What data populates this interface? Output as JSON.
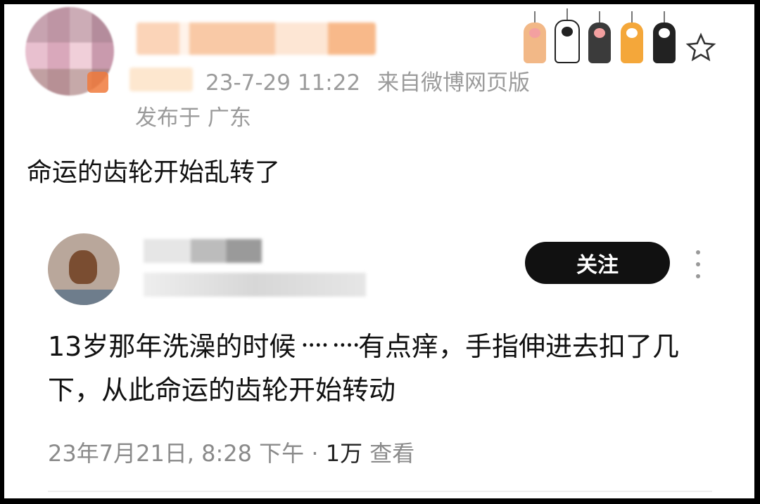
{
  "post": {
    "timestamp": "23-7-29 11:22",
    "source": "来自微博网页版",
    "location": "发布于 广东",
    "text": "命运的齿轮开始乱转了"
  },
  "decor": {
    "paw_colors": [
      "#f2b887",
      "#ffffff",
      "#3b3b3b",
      "#f4a73a",
      "#222222"
    ],
    "star_icon": "star-outline-icon"
  },
  "quoted": {
    "follow_label": "关注",
    "text": "13岁那年洗澡的时候᠁᠁有点痒，手指伸进去扣了几下，从此命运的齿轮开始转动",
    "meta_date": "23年7月21日, 8:28 下午 ·",
    "views_count": "1万",
    "views_label": "查看"
  }
}
